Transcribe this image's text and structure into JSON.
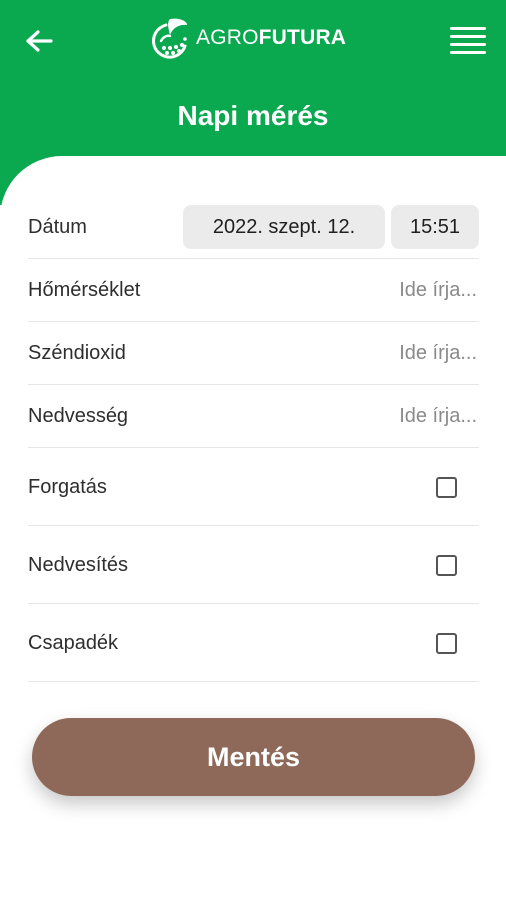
{
  "header": {
    "logo": {
      "prefix": "AGRO",
      "suffix": "FUTURA"
    },
    "title": "Napi mérés",
    "back_icon": "arrow-left-icon",
    "menu_icon": "hamburger-menu-icon"
  },
  "colors": {
    "primary_green": "#0aa84f",
    "save_brown": "#8e6959",
    "field_bg": "#ebebeb"
  },
  "form": {
    "date": {
      "label": "Dátum",
      "date_value": "2022. szept. 12.",
      "time_value": "15:51"
    },
    "temperature": {
      "label": "Hőmérséklet",
      "placeholder": "Ide írja..."
    },
    "co2": {
      "label": "Széndioxid",
      "placeholder": "Ide írja..."
    },
    "humidity": {
      "label": "Nedvesség",
      "placeholder": "Ide írja..."
    },
    "rotation": {
      "label": "Forgatás",
      "checked": false
    },
    "moistening": {
      "label": "Nedvesítés",
      "checked": false
    },
    "precipitation": {
      "label": "Csapadék",
      "checked": false
    }
  },
  "save_button": {
    "label": "Mentés"
  }
}
